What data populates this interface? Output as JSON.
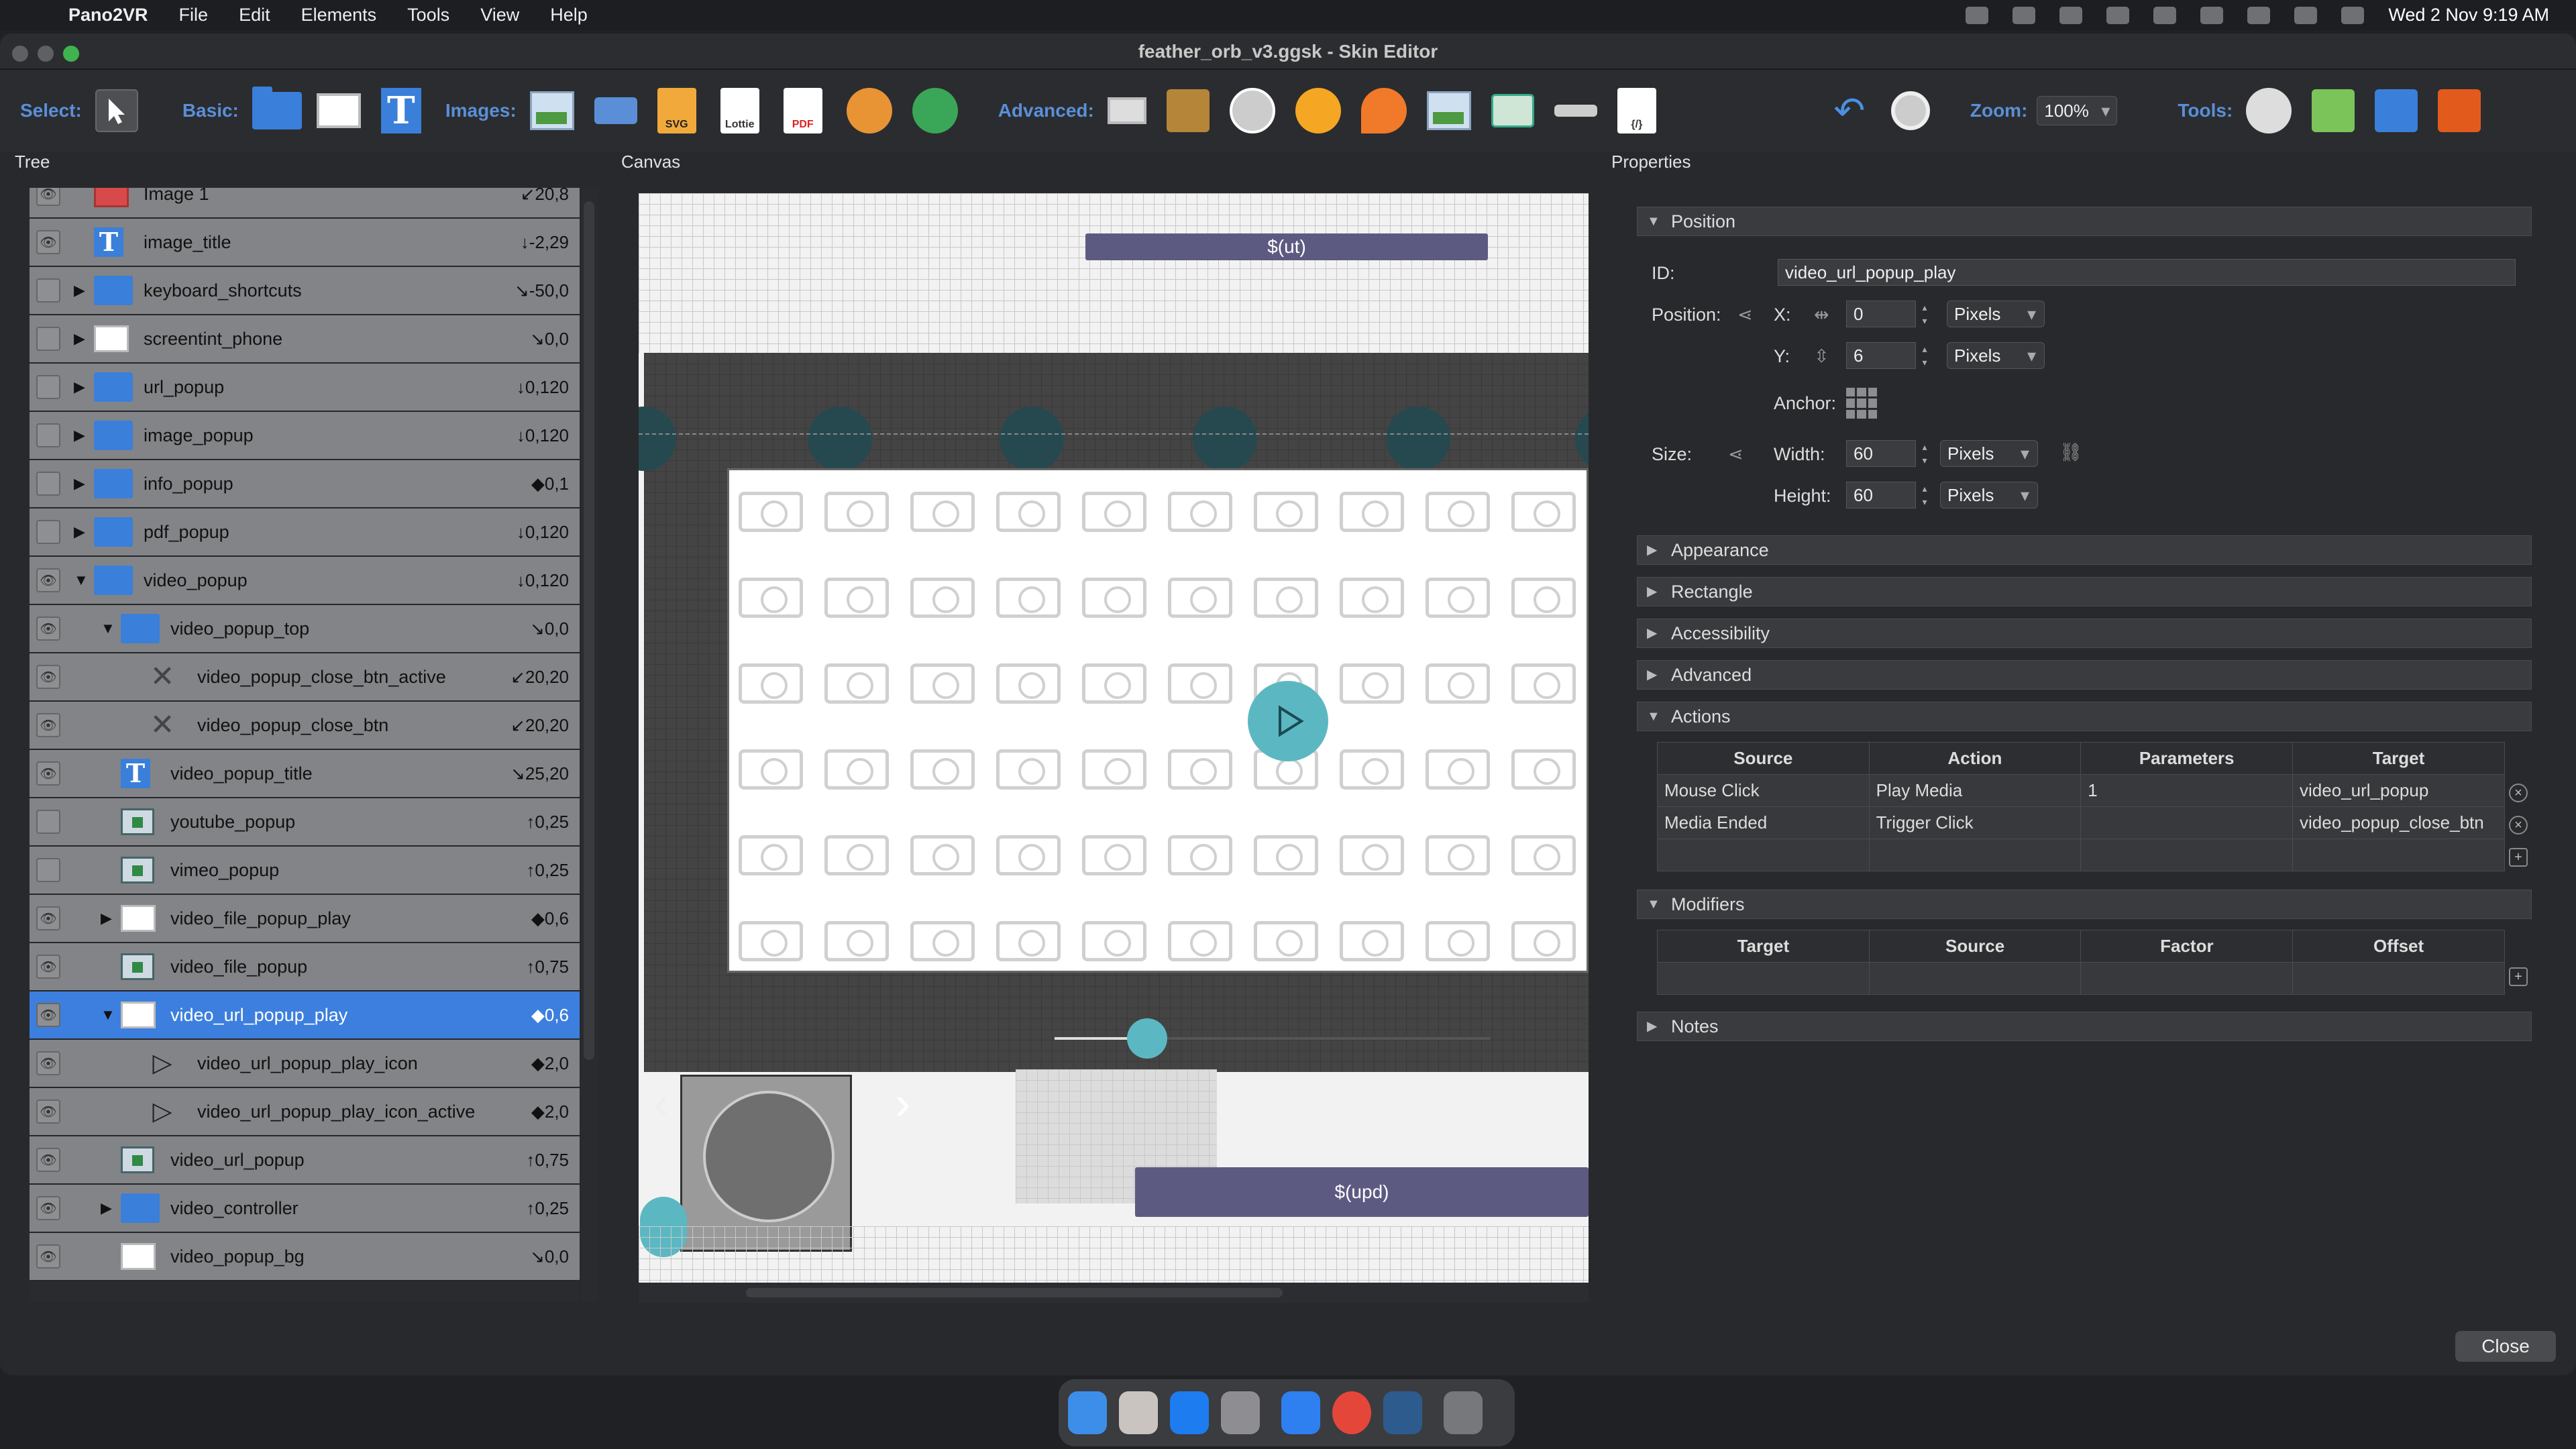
{
  "menubar": {
    "app_name": "Pano2VR",
    "items": [
      "File",
      "Edit",
      "Elements",
      "Tools",
      "View",
      "Help"
    ],
    "clock": "Wed 2 Nov  9:19 AM"
  },
  "window": {
    "title": "feather_orb_v3.ggsk - Skin Editor"
  },
  "toolbar": {
    "select_label": "Select:",
    "basic_label": "Basic:",
    "images_label": "Images:",
    "advanced_label": "Advanced:",
    "zoom_label": "Zoom:",
    "zoom_value": "100%",
    "tools_label": "Tools:",
    "image_tools": [
      {
        "icon": "image-icon"
      },
      {
        "icon": "button-image-icon"
      },
      {
        "icon": "svg-icon",
        "text": "SVG"
      },
      {
        "icon": "lottie-icon",
        "text": "Lottie"
      },
      {
        "icon": "pdf-icon",
        "text": "PDF"
      },
      {
        "icon": "sphere-icon"
      },
      {
        "icon": "panorama-icon"
      }
    ]
  },
  "panels": {
    "tree": "Tree",
    "canvas": "Canvas",
    "properties": "Properties"
  },
  "tree": {
    "rows": [
      {
        "name": "Image 1",
        "pos": "↙20,8",
        "icon": "image",
        "depth": 0,
        "expander": "",
        "visible": true
      },
      {
        "name": "image_title",
        "pos": "↓-2,29",
        "icon": "text",
        "depth": 0,
        "expander": "",
        "visible": true
      },
      {
        "name": "keyboard_shortcuts",
        "pos": "↘-50,0",
        "icon": "folder",
        "depth": 0,
        "expander": "▶",
        "visible": false
      },
      {
        "name": "screentint_phone",
        "pos": "↘0,0",
        "icon": "white",
        "depth": 0,
        "expander": "▶",
        "visible": false
      },
      {
        "name": "url_popup",
        "pos": "↓0,120",
        "icon": "folder",
        "depth": 0,
        "expander": "▶",
        "visible": false
      },
      {
        "name": "image_popup",
        "pos": "↓0,120",
        "icon": "folder",
        "depth": 0,
        "expander": "▶",
        "visible": false
      },
      {
        "name": "info_popup",
        "pos": "◆0,1",
        "icon": "folder",
        "depth": 0,
        "expander": "▶",
        "visible": false
      },
      {
        "name": "pdf_popup",
        "pos": "↓0,120",
        "icon": "folder",
        "depth": 0,
        "expander": "▶",
        "visible": false
      },
      {
        "name": "video_popup",
        "pos": "↓0,120",
        "icon": "folder",
        "depth": 0,
        "expander": "▼",
        "visible": true
      },
      {
        "name": "video_popup_top",
        "pos": "↘0,0",
        "icon": "folder",
        "depth": 1,
        "expander": "▼",
        "visible": true
      },
      {
        "name": "video_popup_close_btn_active",
        "pos": "↙20,20",
        "icon": "cross",
        "depth": 2,
        "expander": "",
        "visible": true
      },
      {
        "name": "video_popup_close_btn",
        "pos": "↙20,20",
        "icon": "cross",
        "depth": 2,
        "expander": "",
        "visible": true
      },
      {
        "name": "video_popup_title",
        "pos": "↘25,20",
        "icon": "text",
        "depth": 1,
        "expander": "",
        "visible": true
      },
      {
        "name": "youtube_popup",
        "pos": "↑0,25",
        "icon": "video",
        "depth": 1,
        "expander": "",
        "visible": false
      },
      {
        "name": "vimeo_popup",
        "pos": "↑0,25",
        "icon": "video",
        "depth": 1,
        "expander": "",
        "visible": false
      },
      {
        "name": "video_file_popup_play",
        "pos": "◆0,6",
        "icon": "white",
        "depth": 1,
        "expander": "▶",
        "visible": true
      },
      {
        "name": "video_file_popup",
        "pos": "↑0,75",
        "icon": "video",
        "depth": 1,
        "expander": "",
        "visible": true
      },
      {
        "name": "video_url_popup_play",
        "pos": "◆0,6",
        "icon": "white",
        "depth": 1,
        "expander": "▼",
        "visible": true,
        "selected": true
      },
      {
        "name": "video_url_popup_play_icon",
        "pos": "◆2,0",
        "icon": "play",
        "depth": 2,
        "expander": "",
        "visible": true
      },
      {
        "name": "video_url_popup_play_icon_active",
        "pos": "◆2,0",
        "icon": "play",
        "depth": 2,
        "expander": "",
        "visible": true
      },
      {
        "name": "video_url_popup",
        "pos": "↑0,75",
        "icon": "video",
        "depth": 1,
        "expander": "",
        "visible": true
      },
      {
        "name": "video_controller",
        "pos": "↑0,25",
        "icon": "folder",
        "depth": 1,
        "expander": "▶",
        "visible": true
      },
      {
        "name": "video_popup_bg",
        "pos": "↘0,0",
        "icon": "white",
        "depth": 1,
        "expander": "",
        "visible": true
      }
    ]
  },
  "canvas": {
    "top_button_text": "$(ut)",
    "bottom_button_text": "$(upd)",
    "accent_color": "#5bb8c2",
    "button_color": "#5d5a82"
  },
  "properties": {
    "position_section": "Position",
    "id_label": "ID:",
    "id_value": "video_url_popup_play",
    "position_label": "Position:",
    "x_label": "X:",
    "x_value": "0",
    "x_unit": "Pixels",
    "y_label": "Y:",
    "y_value": "6",
    "y_unit": "Pixels",
    "anchor_label": "Anchor:",
    "size_label": "Size:",
    "width_label": "Width:",
    "width_value": "60",
    "width_unit": "Pixels",
    "height_label": "Height:",
    "height_value": "60",
    "height_unit": "Pixels",
    "sections": [
      "Appearance",
      "Rectangle",
      "Accessibility",
      "Advanced"
    ],
    "actions_section": "Actions",
    "actions_headers": [
      "Source",
      "Action",
      "Parameters",
      "Target"
    ],
    "actions_rows": [
      [
        "Mouse Click",
        "Play Media",
        "1",
        "video_url_popup"
      ],
      [
        "Media Ended",
        "Trigger Click",
        "",
        "video_popup_close_btn"
      ]
    ],
    "modifiers_section": "Modifiers",
    "modifiers_headers": [
      "Target",
      "Source",
      "Factor",
      "Offset"
    ],
    "notes_section": "Notes",
    "close_label": "Close"
  }
}
